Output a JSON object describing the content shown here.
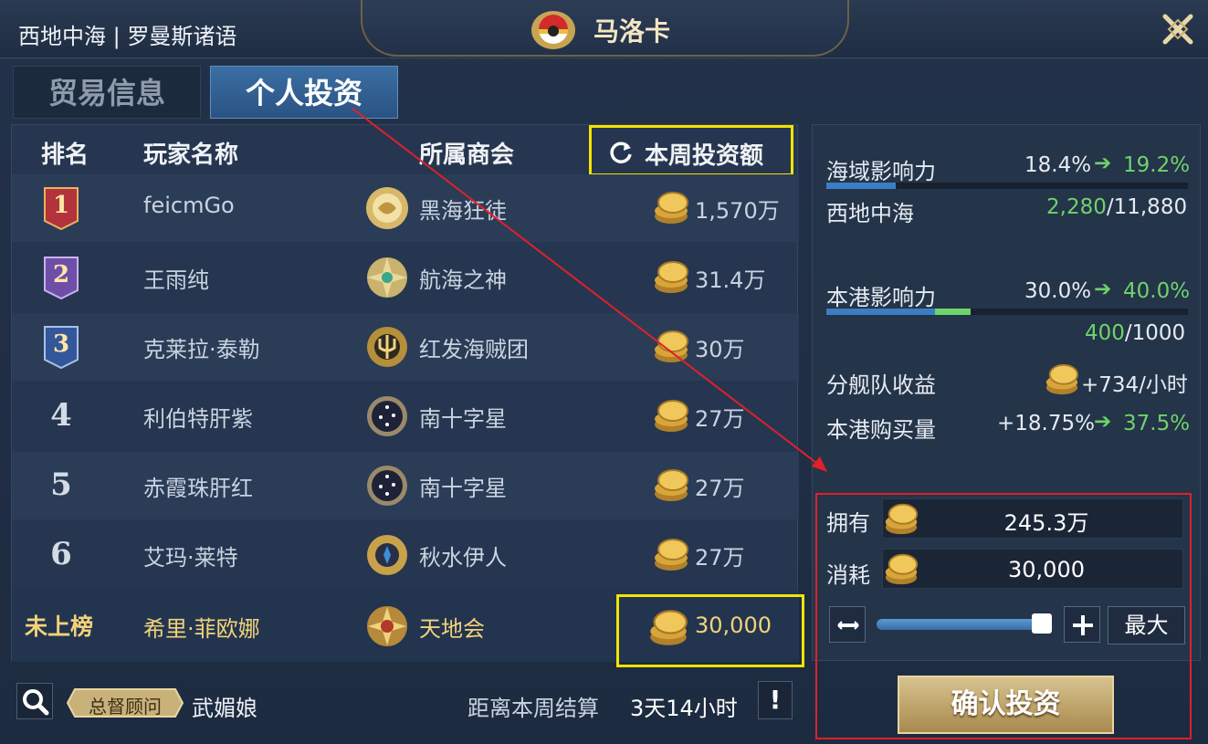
{
  "header": {
    "region": "西地中海 | 罗曼斯诸语",
    "city": "马洛卡",
    "close_icon": "close-x-icon"
  },
  "tabs": [
    {
      "label": "贸易信息",
      "active": false
    },
    {
      "label": "个人投资",
      "active": true
    }
  ],
  "table": {
    "columns": [
      "排名",
      "玩家名称",
      "所属商会",
      "本周投资额"
    ],
    "refresh_icon": "refresh-icon",
    "rows": [
      {
        "rank": "1",
        "player": "feicmGo",
        "guild": "黑海狂徒",
        "amount": "1,570万"
      },
      {
        "rank": "2",
        "player": "王雨纯",
        "guild": "航海之神",
        "amount": "31.4万"
      },
      {
        "rank": "3",
        "player": "克莱拉·泰勒",
        "guild": "红发海贼团",
        "amount": "30万"
      },
      {
        "rank": "4",
        "player": "利伯特肝紫",
        "guild": "南十字星",
        "amount": "27万"
      },
      {
        "rank": "5",
        "player": "赤霞珠肝红",
        "guild": "南十字星",
        "amount": "27万"
      },
      {
        "rank": "6",
        "player": "艾玛·莱特",
        "guild": "秋水伊人",
        "amount": "27万"
      }
    ],
    "self_row": {
      "rank": "未上榜",
      "player": "希里·菲欧娜",
      "guild": "天地会",
      "amount": "30,000"
    }
  },
  "footer": {
    "search_icon": "search-icon",
    "badge": "总督顾问",
    "admirer_name": "武媚娘",
    "settle_label": "距离本周结算",
    "settle_time": "3天14小时",
    "info_label": "!"
  },
  "stats": {
    "sea_influence_label": "海域影响力",
    "sea_influence_from": "18.4%",
    "sea_influence_to": "19.2%",
    "sea_influence_fraction": 0.192,
    "sea_name": "西地中海",
    "sea_progress_current": "2,280",
    "sea_progress_total": "/11,880",
    "port_influence_label": "本港影响力",
    "port_influence_from": "30.0%",
    "port_influence_to": "40.0%",
    "port_influence_fraction_from": 0.3,
    "port_influence_fraction_to": 0.4,
    "port_progress_current": "400",
    "port_progress_total": "/1000",
    "fleet_income_label": "分舰队收益",
    "fleet_income_value": "+734/小时",
    "purchase_label": "本港购买量",
    "purchase_from": "+18.75%",
    "purchase_to": "37.5%"
  },
  "invest": {
    "owned_label": "拥有",
    "owned_value": "245.3万",
    "cost_label": "消耗",
    "cost_value": "30,000",
    "slider_fraction": 0.95,
    "max_label": "最大",
    "confirm_label": "确认投资"
  },
  "colors": {
    "accent_green": "#6fd36b",
    "highlight_yellow": "#f5e300",
    "annotation_red": "#e0202a",
    "gold": "#f2d37a"
  }
}
